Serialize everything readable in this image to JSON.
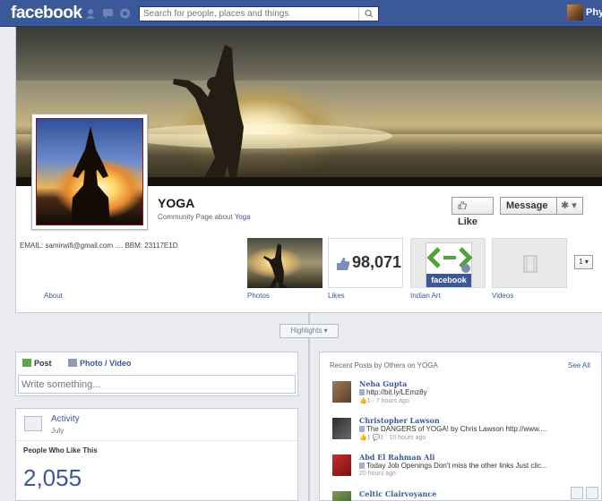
{
  "topbar": {
    "logo": "facebook",
    "search_placeholder": "Search for people, places and things",
    "user_name": "Phyl"
  },
  "page": {
    "name": "YOGA",
    "subtitle_prefix": "Community Page about ",
    "subtitle_link": "Yoga",
    "like_label": "Like",
    "message_label": "Message",
    "contact": "EMAIL: samirwifi@gmail.com .... BBM: 23117E1D"
  },
  "nav": {
    "about": "About",
    "photos": "Photos",
    "likes": "Likes",
    "likes_count": "98,071",
    "indian_art": "Indian Art",
    "videos": "Videos",
    "more": "1"
  },
  "highlights": "Highlights",
  "composer": {
    "post_tab": "Post",
    "photo_tab": "Photo / Video",
    "placeholder": "Write something..."
  },
  "activity": {
    "title": "Activity",
    "month": "July",
    "likers_heading": "People Who Like This",
    "likers_count": "2,055"
  },
  "recent": {
    "heading": "Recent Posts by Others on YOGA",
    "see_all": "See All",
    "posts": [
      {
        "name": "Neha Gupta",
        "text": "http://bit.ly/LEmz8y",
        "meta_counts": "1",
        "time": "7 hours ago"
      },
      {
        "name": "Christopher Lawson",
        "text": "The DANGERS of YOGA! by Chris Lawson http://www....",
        "meta_counts": "1",
        "meta_comments": "1",
        "time": "10 hours ago"
      },
      {
        "name": "Abd El Rahman Ali",
        "text": "Today Job Openings Don't miss the other links Just clic...",
        "time": "20 hours ago"
      },
      {
        "name": "Celtic Clairvoyance"
      }
    ]
  }
}
